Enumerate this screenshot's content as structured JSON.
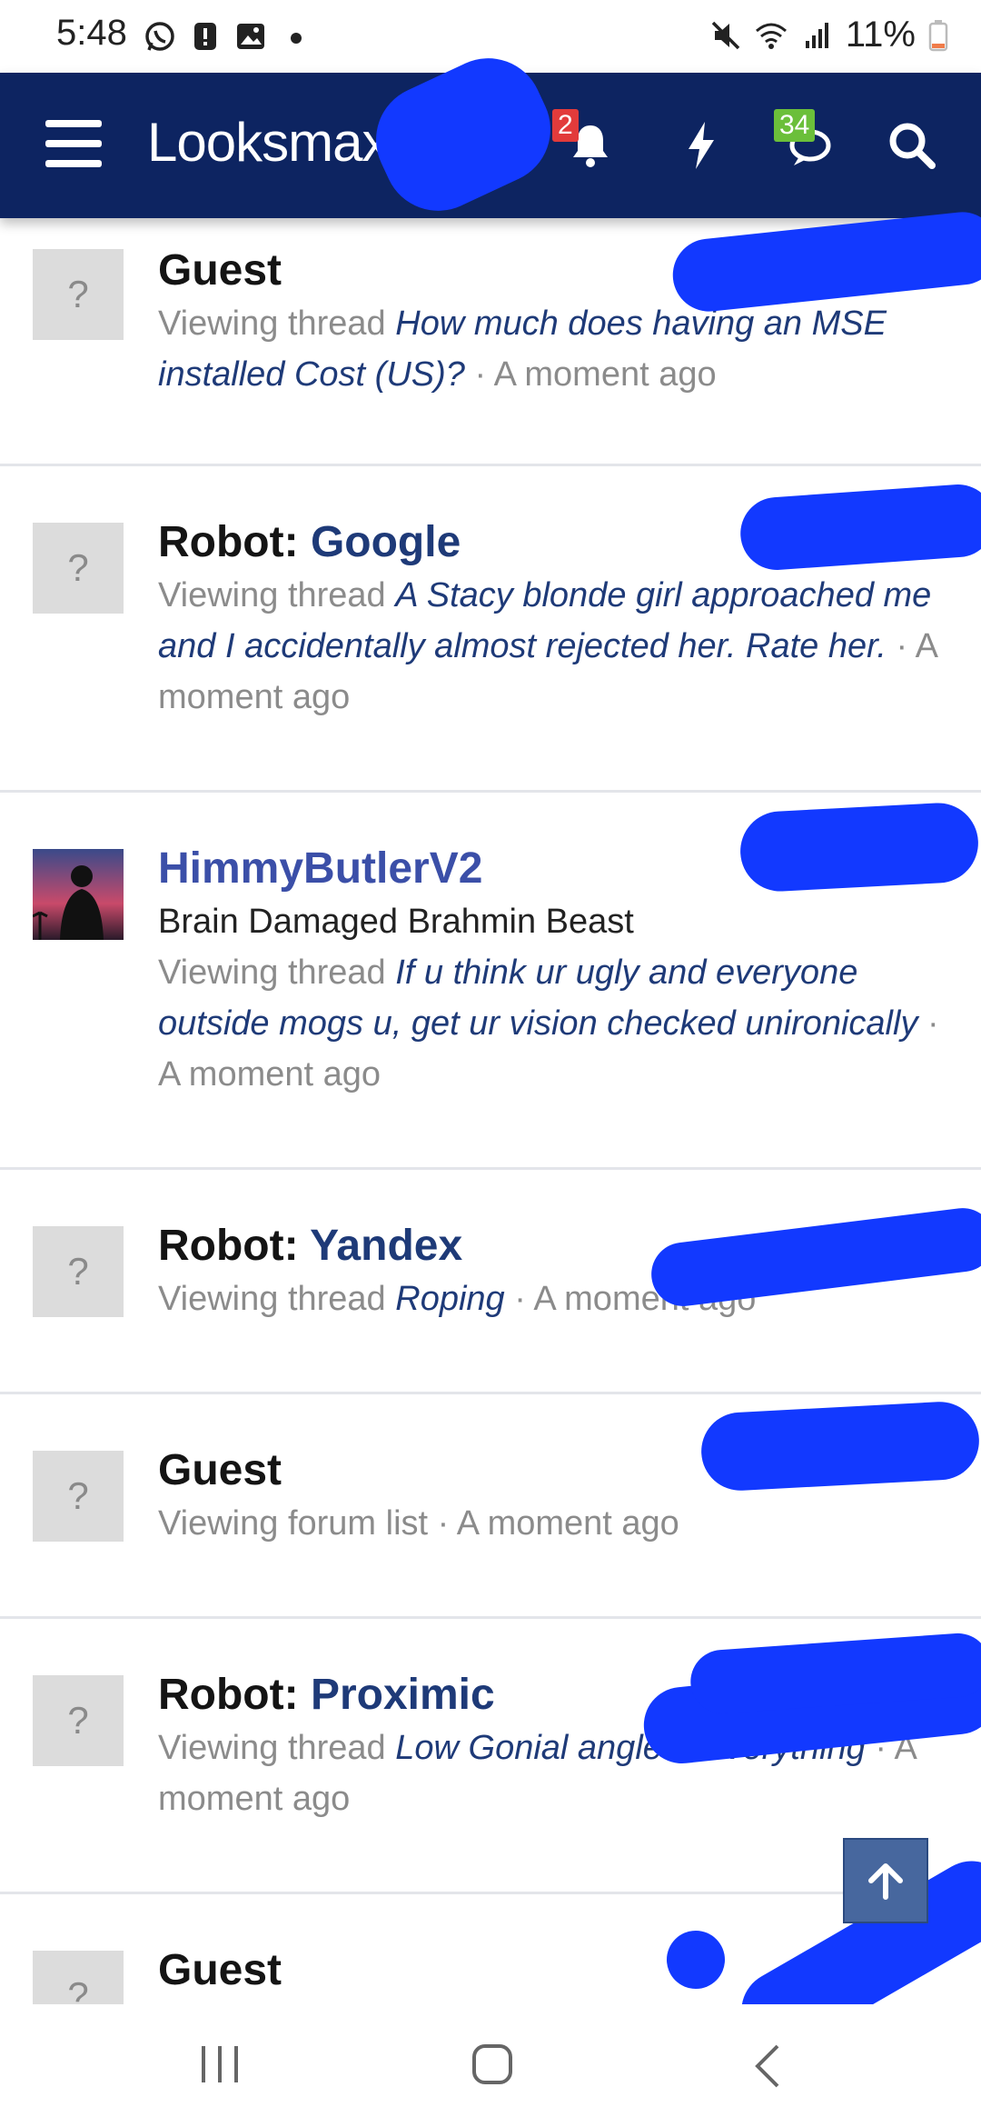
{
  "status_bar": {
    "time": "5:48",
    "battery": "11%",
    "left_icons": [
      "whatsapp-icon",
      "alert-icon",
      "gallery-icon",
      "dot-icon"
    ],
    "right_icons": [
      "mute-icon",
      "wifi-icon",
      "signal-icon",
      "battery-icon"
    ]
  },
  "header": {
    "logo": "Looksmax",
    "notifications_badge": "2",
    "conversations_badge": "34",
    "colors": {
      "background": "#0d2461",
      "badge_red": "#e23b3b",
      "badge_green": "#6bbf3a"
    }
  },
  "online_list": [
    {
      "avatar_text": "?",
      "name_prefix": "Guest",
      "name_suffix": "",
      "title": "",
      "activity_prefix": "Viewing thread ",
      "thread": "How much does having an MSE installed Cost (US)?",
      "time": " · A moment ago"
    },
    {
      "avatar_text": "?",
      "name_prefix": "Robot: ",
      "name_suffix": "Google",
      "title": "",
      "activity_prefix": "Viewing thread ",
      "thread": "A Stacy blonde girl approached me and I accidentally almost rejected her. Rate her.",
      "time": " · A moment ago"
    },
    {
      "avatar_text": "",
      "name_prefix": "HimmyButlerV2",
      "name_suffix": "",
      "title": "Brain Damaged Brahmin Beast",
      "activity_prefix": "Viewing thread ",
      "thread": "If u think ur ugly and everyone outside mogs u, get ur vision checked unironically",
      "time": " · A moment ago"
    },
    {
      "avatar_text": "?",
      "name_prefix": "Robot: ",
      "name_suffix": "Yandex",
      "title": "",
      "activity_prefix": "Viewing thread ",
      "thread": "Roping",
      "time": " · A moment ago"
    },
    {
      "avatar_text": "?",
      "name_prefix": "Guest",
      "name_suffix": "",
      "title": "",
      "activity_prefix": "Viewing forum list",
      "thread": "",
      "time": " · A moment ago"
    },
    {
      "avatar_text": "?",
      "name_prefix": "Robot: ",
      "name_suffix": "Proximic",
      "title": "",
      "activity_prefix": "Viewing thread ",
      "thread": "Low Gonial angle is everything",
      "time": " · A moment ago"
    },
    {
      "avatar_text": "?",
      "name_prefix": "Guest",
      "name_suffix": "",
      "title": "",
      "activity_prefix": "",
      "thread": "",
      "time": ""
    }
  ]
}
